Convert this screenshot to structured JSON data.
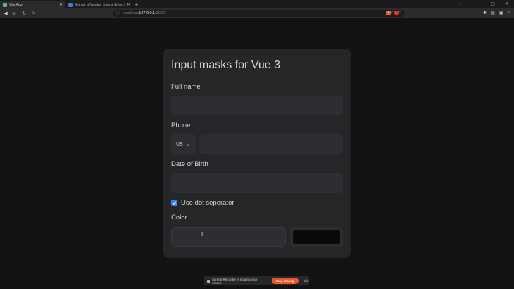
{
  "browser": {
    "tabs": [
      {
        "title": "Vite App",
        "active": true,
        "favicon": "vue-icon"
      },
      {
        "title": "Extract a Number from a String in Jav",
        "active": false,
        "favicon": "web-icon"
      }
    ],
    "new_tab": "+",
    "url": {
      "scheme": "localhost:",
      "host": "127.0.0.1",
      "port": ":3000/"
    },
    "window_controls": {
      "minimize": "–",
      "maximize": "▢",
      "close": "✕",
      "tabs_dropdown": "⌄"
    }
  },
  "form": {
    "title": "Input masks for Vue 3",
    "full_name": {
      "label": "Full name",
      "value": ""
    },
    "phone": {
      "label": "Phone",
      "country": "US",
      "value": ""
    },
    "dob": {
      "label": "Date of Birth",
      "value": ""
    },
    "dot_separator": {
      "label": "Use dot seperator",
      "checked": true
    },
    "color": {
      "label": "Color",
      "value": "",
      "swatch": "#0a0a0a"
    }
  },
  "recorder": {
    "message": "Screen Recorder is sharing your screen.",
    "stop_label": "Stop sharing",
    "hide_label": "Hide"
  },
  "colors": {
    "accent": "#3b82f6",
    "card": "#252628",
    "stop": "#e8562b"
  }
}
